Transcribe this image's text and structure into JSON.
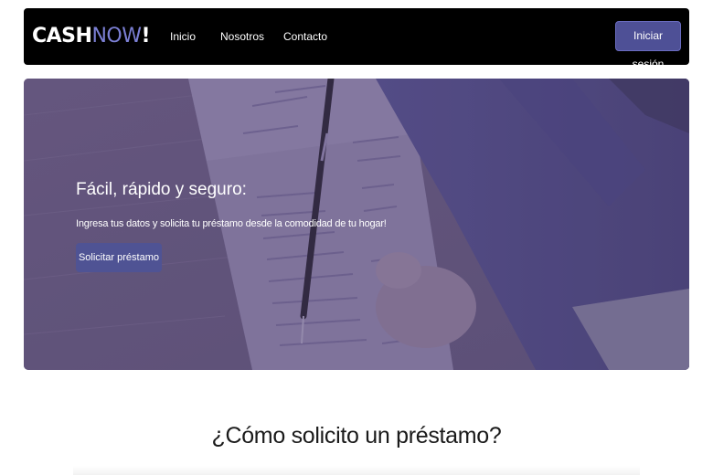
{
  "brand": {
    "part1": "CASH",
    "part2": "NOW",
    "part3": "!"
  },
  "nav": {
    "items": [
      {
        "label": "Inicio"
      },
      {
        "label": "Nosotros"
      },
      {
        "label": "Contacto"
      }
    ],
    "login_label": "Iniciar sesión"
  },
  "hero": {
    "title": "Fácil, rápido y seguro:",
    "subtitle": "Ingresa tus datos y solicita tu préstamo desde la comodidad de tu hogar!",
    "button_label": "Solicitar préstamo"
  },
  "section": {
    "title": "¿Cómo solicito un préstamo?"
  },
  "colors": {
    "navbar_bg": "#000000",
    "brand_accent": "#7b7fd4",
    "button_bg": "#4e5096",
    "hero_overlay": "#6d6188"
  }
}
